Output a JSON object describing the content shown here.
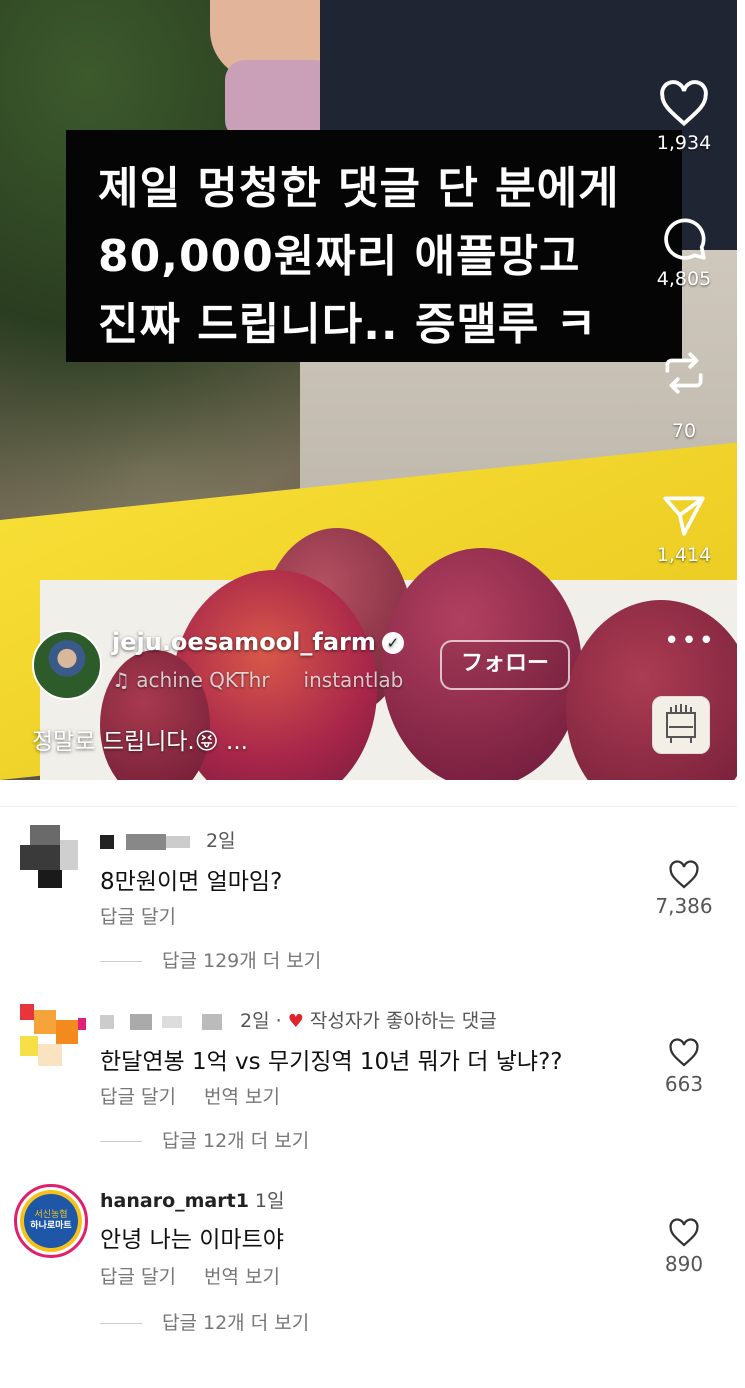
{
  "video": {
    "caption_lines": [
      "제일 멍청한 댓글 단 분에게",
      "80,000원짜리 애플망고",
      "진짜 드립니다.. 증맬루 ㅋ"
    ],
    "username": "jeju.oesamool_farm",
    "music_text": "achine QKThr",
    "music_text_2": "instantlab",
    "follow_label": "フォロー",
    "description": "정말로 드립니다.😝 ...",
    "likes": "1,934",
    "comments": "4,805",
    "reposts": "70",
    "shares": "1,414",
    "more_label": "•••"
  },
  "comments": [
    {
      "username": "",
      "time": "2일",
      "text": "8만원이면 얼마임?",
      "reply_label": "답글 달기",
      "likes": "7,386",
      "view_replies": "답글 129개 더 보기"
    },
    {
      "username": "",
      "time": "2일 ·",
      "liked_by_author": "작성자가 좋아하는 댓글",
      "text": "한달연봉 1억 vs 무기징역 10년 뭐가 더 낳냐??",
      "reply_label": "답글 달기",
      "translate_label": "번역 보기",
      "likes": "663",
      "view_replies": "답글 12개 더 보기"
    },
    {
      "username": "hanaro_mart1",
      "time": "1일",
      "text": "안녕 나는 이마트야",
      "reply_label": "답글 달기",
      "translate_label": "번역 보기",
      "likes": "890",
      "view_replies": "답글 12개 더 보기",
      "avatar_text_top": "서신농협",
      "avatar_text_bottom": "하나로마트"
    }
  ]
}
